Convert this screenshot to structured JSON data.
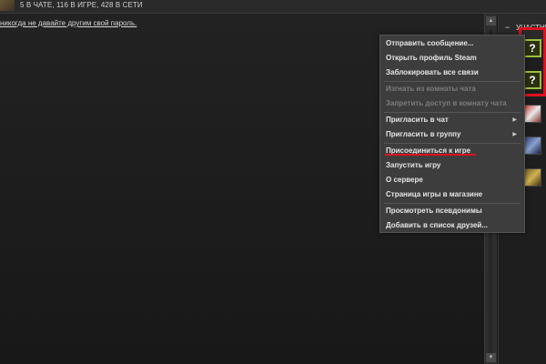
{
  "topbar": {
    "status": "5 В ЧАТЕ, 116 В ИГРЕ, 428 В СЕТИ"
  },
  "chat": {
    "message": "никогда не давайте другим свой пароль."
  },
  "members": {
    "minus": "−",
    "label": "УЧАСТНИ",
    "avatars": [
      "?",
      "?"
    ]
  },
  "context_menu": {
    "items": [
      {
        "label": "Отправить сообщение...",
        "enabled": true
      },
      {
        "label": "Открыть профиль Steam",
        "enabled": true
      },
      {
        "label": "Заблокировать все связи",
        "enabled": true
      },
      {
        "label": "Изгнать из комнаты чата",
        "enabled": false
      },
      {
        "label": "Запретить доступ в комнату чата",
        "enabled": false
      },
      {
        "label": "Пригласить в чат",
        "enabled": true,
        "submenu": true
      },
      {
        "label": "Пригласить в группу",
        "enabled": true,
        "submenu": true
      },
      {
        "label": "Присоединиться к игре",
        "enabled": true
      },
      {
        "label": "Запустить игру",
        "enabled": true
      },
      {
        "label": "О сервере",
        "enabled": true
      },
      {
        "label": "Страница игры в магазине",
        "enabled": true
      },
      {
        "label": "Просмотреть псевдонимы",
        "enabled": true
      },
      {
        "label": "Добавить в список друзей...",
        "enabled": true
      }
    ],
    "submenu_arrow": "▶"
  },
  "scrollbar": {
    "up": "▲",
    "down": "▼"
  },
  "colors": {
    "highlight": "#e01020",
    "menu_bg": "#3d3d3d",
    "avatar_border": "#9cbf3a"
  }
}
